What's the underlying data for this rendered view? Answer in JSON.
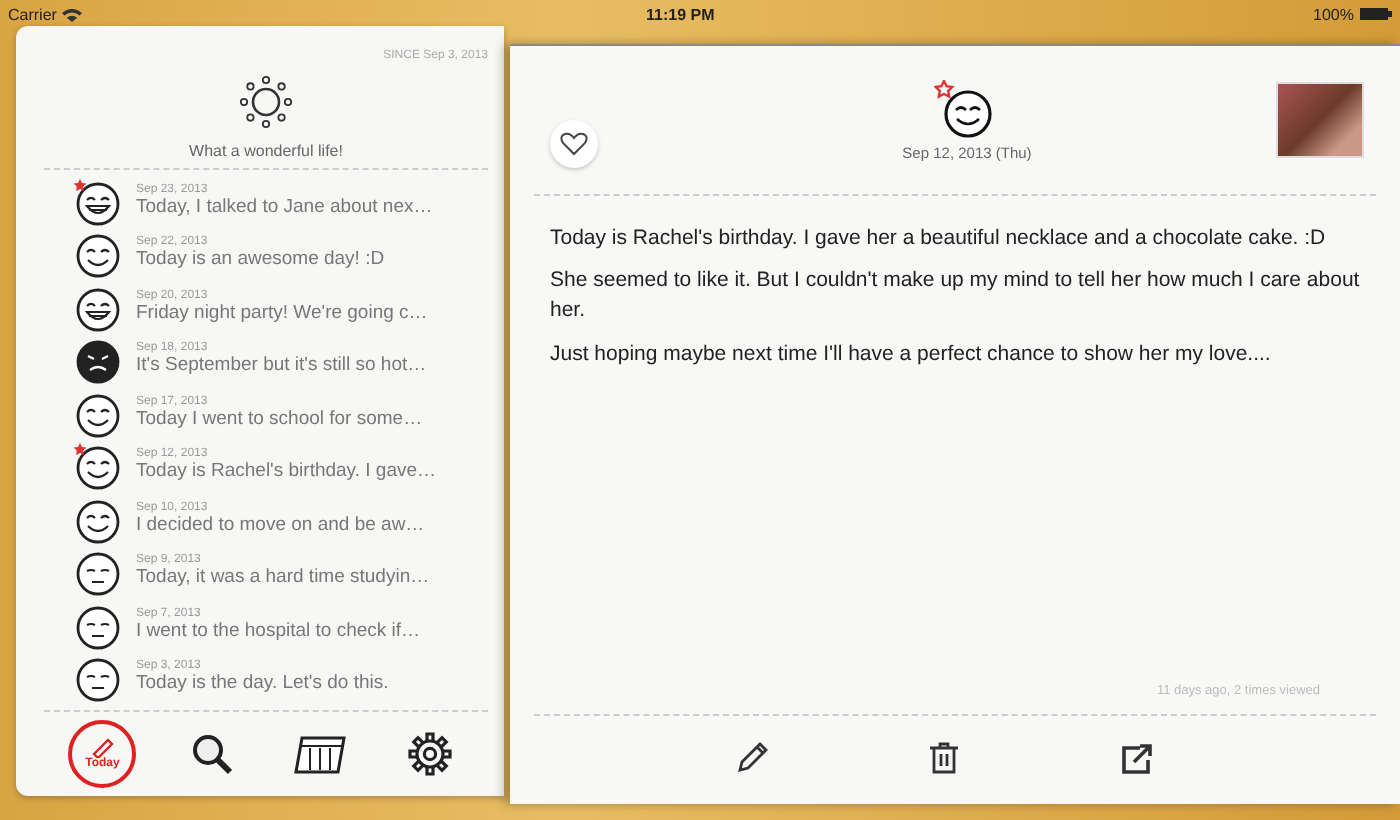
{
  "status_bar": {
    "carrier": "Carrier",
    "time": "11:19 PM",
    "battery": "100%"
  },
  "sidebar": {
    "since": "SINCE Sep 3, 2013",
    "motto": "What a wonderful life!",
    "entries": [
      {
        "date": "Sep 23, 2013",
        "text": "Today, I talked to Jane about nex…",
        "kind": "grin",
        "starred": true
      },
      {
        "date": "Sep 22, 2013",
        "text": "Today is an awesome day! :D",
        "kind": "smile",
        "starred": false
      },
      {
        "date": "Sep 20, 2013",
        "text": "Friday night party! We're going c…",
        "kind": "grin",
        "starred": false
      },
      {
        "date": "Sep 18, 2013",
        "text": "It's September but it's still so hot…",
        "kind": "angry",
        "starred": false
      },
      {
        "date": "Sep 17, 2013",
        "text": "Today I went to school for some…",
        "kind": "smile",
        "starred": false
      },
      {
        "date": "Sep 12, 2013",
        "text": "Today is Rachel's birthday. I gave…",
        "kind": "smile",
        "starred": true
      },
      {
        "date": "Sep 10, 2013",
        "text": "I decided to move on and be aw…",
        "kind": "smile",
        "starred": false
      },
      {
        "date": "Sep 9, 2013",
        "text": "Today, it was a hard time studyin…",
        "kind": "calm",
        "starred": false
      },
      {
        "date": "Sep 7, 2013",
        "text": "I went to the hospital to check if…",
        "kind": "calm",
        "starred": false
      },
      {
        "date": "Sep 3, 2013",
        "text": "Today is the day. Let's do this.",
        "kind": "calm",
        "starred": false
      }
    ],
    "tabs": [
      {
        "kind": "today",
        "label": "Today",
        "selected": true
      },
      {
        "kind": "search",
        "selected": false
      },
      {
        "kind": "calendar",
        "selected": false
      },
      {
        "kind": "settings",
        "selected": false
      }
    ]
  },
  "entry": {
    "liked": false,
    "starred": true,
    "date": "Sep 12, 2013 (Thu)",
    "paragraphs": [
      "Today is Rachel's birthday. I gave her a beautiful necklace and a chocolate cake. :D",
      "She seemed to like it. But I couldn't make up my mind to tell her how much I care about her.",
      "Just hoping maybe next time I'll have a perfect chance to show her my love...."
    ],
    "meta": "11 days ago, 2 times viewed",
    "actions": [
      {
        "kind": "edit"
      },
      {
        "kind": "delete"
      },
      {
        "kind": "share"
      }
    ]
  }
}
